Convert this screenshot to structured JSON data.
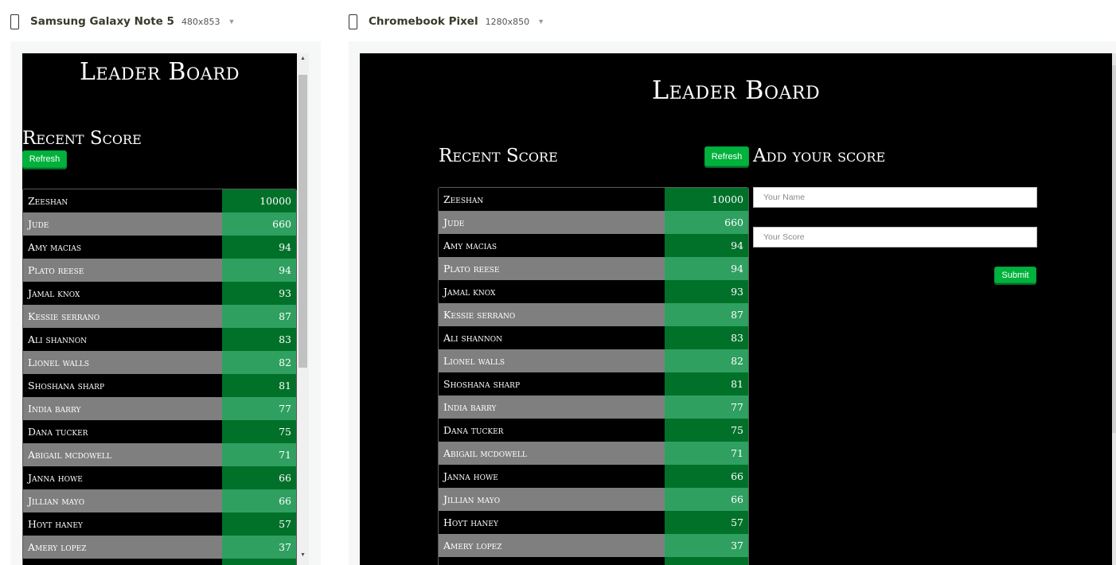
{
  "devices": [
    {
      "name": "Samsung Galaxy Note 5",
      "size": "480x853"
    },
    {
      "name": "Chromebook Pixel",
      "size": "1280x850"
    }
  ],
  "app": {
    "title": "Leader Board",
    "recent_title": "Recent Score",
    "refresh_label": "Refresh",
    "add_title": "Add your score",
    "name_placeholder": "Your Name",
    "score_placeholder": "Your Score",
    "submit_label": "Submit"
  },
  "scores": [
    {
      "name": "Zeeshan",
      "score": "10000"
    },
    {
      "name": "Jude",
      "score": "660"
    },
    {
      "name": "Amy macias",
      "score": "94"
    },
    {
      "name": "Plato reese",
      "score": "94"
    },
    {
      "name": "Jamal knox",
      "score": "93"
    },
    {
      "name": "Kessie serrano",
      "score": "87"
    },
    {
      "name": "Ali shannon",
      "score": "83"
    },
    {
      "name": "Lionel walls",
      "score": "82"
    },
    {
      "name": "Shoshana sharp",
      "score": "81"
    },
    {
      "name": "India barry",
      "score": "77"
    },
    {
      "name": "Dana tucker",
      "score": "75"
    },
    {
      "name": "Abigail mcdowell",
      "score": "71"
    },
    {
      "name": "Janna howe",
      "score": "66"
    },
    {
      "name": "Jillian mayo",
      "score": "66"
    },
    {
      "name": "Hoyt haney",
      "score": "57"
    },
    {
      "name": "Amery lopez",
      "score": "37"
    },
    {
      "name": "",
      "score": ""
    }
  ],
  "colors": {
    "button_green": "#00b23c",
    "score_dark": "#01712a",
    "score_light": "#2fa060",
    "name_gray": "#7f7f7f"
  }
}
